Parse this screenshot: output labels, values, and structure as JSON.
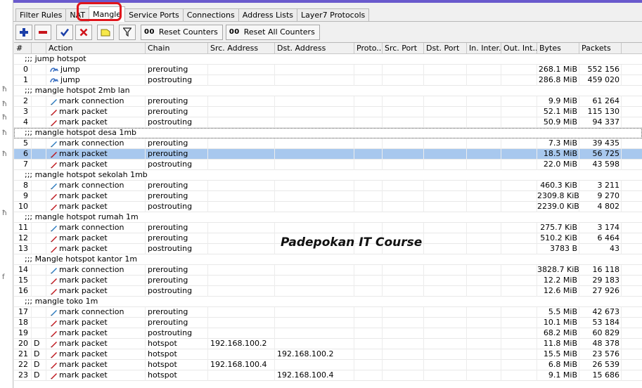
{
  "tabs": [
    "Filter Rules",
    "NAT",
    "Mangle",
    "Service Ports",
    "Connections",
    "Address Lists",
    "Layer7 Protocols"
  ],
  "active_tab": "Mangle",
  "toolbar": {
    "add_icon": "plus-icon",
    "remove_icon": "minus-icon",
    "enable_icon": "check-icon",
    "disable_icon": "x-icon",
    "comment_icon": "note-icon",
    "filter_icon": "funnel-icon",
    "reset_counters_prefix": "00",
    "reset_counters_label": "Reset Counters",
    "reset_all_prefix": "00",
    "reset_all_label": "Reset All Counters"
  },
  "columns": [
    "#",
    "",
    "Action",
    "Chain",
    "Src. Address",
    "Dst. Address",
    "Proto...",
    "Src. Port",
    "Dst. Port",
    "In. Inter...",
    "Out. Int...",
    "Bytes",
    "Packets"
  ],
  "colors": {
    "selected_row": "#a8c8ee",
    "highlight": "#e0141b",
    "top_strip": "#6a5acd"
  },
  "rows": [
    {
      "type": "comment",
      "text": ";;; jump hotspot"
    },
    {
      "type": "rule",
      "idx": "0",
      "flag": "",
      "action": "jump",
      "icon": "jump-icon",
      "chain": "prerouting",
      "src": "",
      "dst": "",
      "bytes": "268.1 MiB",
      "packets": "552 156"
    },
    {
      "type": "rule",
      "idx": "1",
      "flag": "",
      "action": "jump",
      "icon": "jump-icon",
      "chain": "postrouting",
      "src": "",
      "dst": "",
      "bytes": "286.8 MiB",
      "packets": "459 020"
    },
    {
      "type": "comment",
      "text": ";;; mangle hotspot 2mb lan"
    },
    {
      "type": "rule",
      "idx": "2",
      "flag": "",
      "action": "mark connection",
      "icon": "pencil-blue-icon",
      "chain": "prerouting",
      "src": "",
      "dst": "",
      "bytes": "9.9 MiB",
      "packets": "61 264"
    },
    {
      "type": "rule",
      "idx": "3",
      "flag": "",
      "action": "mark packet",
      "icon": "pencil-red-icon",
      "chain": "prerouting",
      "src": "",
      "dst": "",
      "bytes": "52.1 MiB",
      "packets": "115 130"
    },
    {
      "type": "rule",
      "idx": "4",
      "flag": "",
      "action": "mark packet",
      "icon": "pencil-red-icon",
      "chain": "postrouting",
      "src": "",
      "dst": "",
      "bytes": "50.9 MiB",
      "packets": "94 337"
    },
    {
      "type": "comment",
      "text": ";;; mangle hotspot desa 1mb",
      "focused": true
    },
    {
      "type": "rule",
      "idx": "5",
      "flag": "",
      "action": "mark connection",
      "icon": "pencil-blue-icon",
      "chain": "prerouting",
      "src": "",
      "dst": "",
      "bytes": "7.3 MiB",
      "packets": "39 435"
    },
    {
      "type": "rule",
      "idx": "6",
      "flag": "",
      "action": "mark packet",
      "icon": "pencil-red-icon",
      "chain": "prerouting",
      "src": "",
      "dst": "",
      "bytes": "18.5 MiB",
      "packets": "56 725",
      "selected": true
    },
    {
      "type": "rule",
      "idx": "7",
      "flag": "",
      "action": "mark packet",
      "icon": "pencil-red-icon",
      "chain": "postrouting",
      "src": "",
      "dst": "",
      "bytes": "22.0 MiB",
      "packets": "43 598"
    },
    {
      "type": "comment",
      "text": ";;; mangle hotspot sekolah 1mb"
    },
    {
      "type": "rule",
      "idx": "8",
      "flag": "",
      "action": "mark connection",
      "icon": "pencil-blue-icon",
      "chain": "prerouting",
      "src": "",
      "dst": "",
      "bytes": "460.3 KiB",
      "packets": "3 211"
    },
    {
      "type": "rule",
      "idx": "9",
      "flag": "",
      "action": "mark packet",
      "icon": "pencil-red-icon",
      "chain": "prerouting",
      "src": "",
      "dst": "",
      "bytes": "2309.8 KiB",
      "packets": "9 270"
    },
    {
      "type": "rule",
      "idx": "10",
      "flag": "",
      "action": "mark packet",
      "icon": "pencil-red-icon",
      "chain": "postrouting",
      "src": "",
      "dst": "",
      "bytes": "2239.0 KiB",
      "packets": "4 802"
    },
    {
      "type": "comment",
      "text": ";;; mangle hotspot rumah 1m"
    },
    {
      "type": "rule",
      "idx": "11",
      "flag": "",
      "action": "mark connection",
      "icon": "pencil-blue-icon",
      "chain": "prerouting",
      "src": "",
      "dst": "",
      "bytes": "275.7 KiB",
      "packets": "3 174"
    },
    {
      "type": "rule",
      "idx": "12",
      "flag": "",
      "action": "mark packet",
      "icon": "pencil-red-icon",
      "chain": "prerouting",
      "src": "",
      "dst": "",
      "bytes": "510.2 KiB",
      "packets": "6 464"
    },
    {
      "type": "rule",
      "idx": "13",
      "flag": "",
      "action": "mark packet",
      "icon": "pencil-red-icon",
      "chain": "postrouting",
      "src": "",
      "dst": "",
      "bytes": "3783 B",
      "packets": "43"
    },
    {
      "type": "comment",
      "text": ";;; Mangle hotspot kantor 1m"
    },
    {
      "type": "rule",
      "idx": "14",
      "flag": "",
      "action": "mark connection",
      "icon": "pencil-blue-icon",
      "chain": "prerouting",
      "src": "",
      "dst": "",
      "bytes": "3828.7 KiB",
      "packets": "16 118"
    },
    {
      "type": "rule",
      "idx": "15",
      "flag": "",
      "action": "mark packet",
      "icon": "pencil-red-icon",
      "chain": "prerouting",
      "src": "",
      "dst": "",
      "bytes": "12.2 MiB",
      "packets": "29 183"
    },
    {
      "type": "rule",
      "idx": "16",
      "flag": "",
      "action": "mark packet",
      "icon": "pencil-red-icon",
      "chain": "postrouting",
      "src": "",
      "dst": "",
      "bytes": "12.6 MiB",
      "packets": "27 926"
    },
    {
      "type": "comment",
      "text": ";;; mangle toko 1m"
    },
    {
      "type": "rule",
      "idx": "17",
      "flag": "",
      "action": "mark connection",
      "icon": "pencil-blue-icon",
      "chain": "prerouting",
      "src": "",
      "dst": "",
      "bytes": "5.5 MiB",
      "packets": "42 673"
    },
    {
      "type": "rule",
      "idx": "18",
      "flag": "",
      "action": "mark packet",
      "icon": "pencil-red-icon",
      "chain": "prerouting",
      "src": "",
      "dst": "",
      "bytes": "10.1 MiB",
      "packets": "53 184"
    },
    {
      "type": "rule",
      "idx": "19",
      "flag": "",
      "action": "mark packet",
      "icon": "pencil-red-icon",
      "chain": "postrouting",
      "src": "",
      "dst": "",
      "bytes": "68.2 MiB",
      "packets": "60 829"
    },
    {
      "type": "rule",
      "idx": "20",
      "flag": "D",
      "action": "mark packet",
      "icon": "pencil-red-icon",
      "chain": "hotspot",
      "src": "192.168.100.2",
      "dst": "",
      "bytes": "11.8 MiB",
      "packets": "48 378"
    },
    {
      "type": "rule",
      "idx": "21",
      "flag": "D",
      "action": "mark packet",
      "icon": "pencil-red-icon",
      "chain": "hotspot",
      "src": "",
      "dst": "192.168.100.2",
      "bytes": "15.5 MiB",
      "packets": "23 576"
    },
    {
      "type": "rule",
      "idx": "22",
      "flag": "D",
      "action": "mark packet",
      "icon": "pencil-red-icon",
      "chain": "hotspot",
      "src": "192.168.100.4",
      "dst": "",
      "bytes": "6.8 MiB",
      "packets": "26 539"
    },
    {
      "type": "rule",
      "idx": "23",
      "flag": "D",
      "action": "mark packet",
      "icon": "pencil-red-icon",
      "chain": "hotspot",
      "src": "",
      "dst": "192.168.100.4",
      "bytes": "9.1 MiB",
      "packets": "15 686"
    }
  ],
  "watermark": "Padepokan IT Course",
  "gutter_marks": [
    "ħ",
    "ħ",
    "ħ",
    "ħ",
    "ħ",
    "ħ",
    "f"
  ]
}
